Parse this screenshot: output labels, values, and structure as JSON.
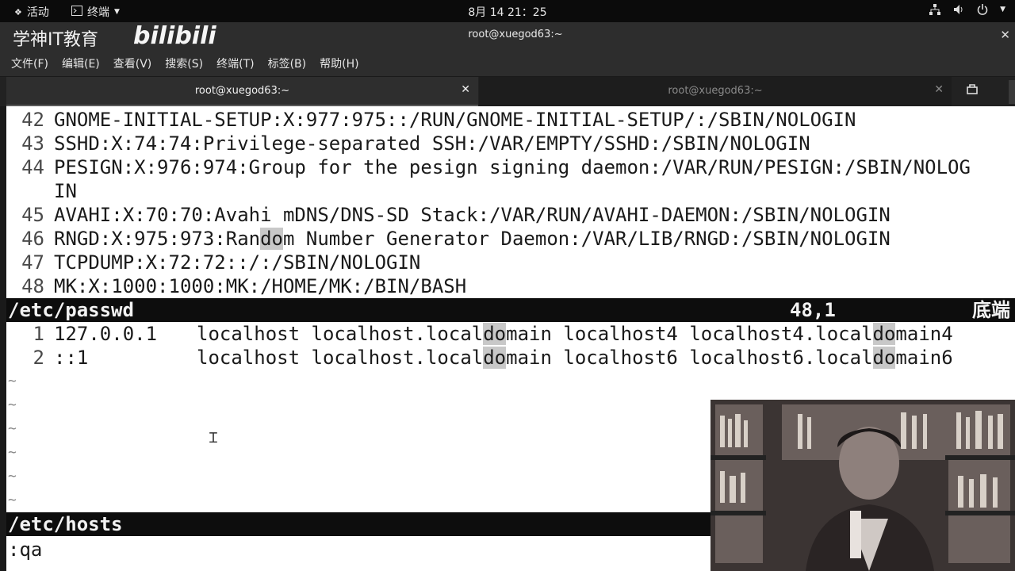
{
  "topbar": {
    "activities": "活动",
    "app": "终端",
    "clock": "8月 14  21：25"
  },
  "window": {
    "title": "root@xuegod63:~",
    "logo_text": "学神IT教育",
    "bili_text": "bilibili"
  },
  "menu": {
    "items": [
      "文件(F)",
      "编辑(E)",
      "查看(V)",
      "搜索(S)",
      "终端(T)",
      "标签(B)",
      "帮助(H)"
    ]
  },
  "tabs": [
    {
      "label": "root@xuegod63:~",
      "active": true
    },
    {
      "label": "root@xuegod63:~",
      "active": false
    }
  ],
  "passwd_lines": [
    {
      "num": "42",
      "text": "GNOME-INITIAL-SETUP:X:977:975::/RUN/GNOME-INITIAL-SETUP/:/SBIN/NOLOGIN"
    },
    {
      "num": "43",
      "text": "SSHD:X:74:74:Privilege-separated SSH:/VAR/EMPTY/SSHD:/SBIN/NOLOGIN"
    },
    {
      "num": "44",
      "text": "PESIGN:X:976:974:Group for the pesign signing daemon:/VAR/RUN/PESIGN:/SBIN/NOLOG"
    },
    {
      "num": "",
      "text": "IN"
    },
    {
      "num": "45",
      "text": "AVAHI:X:70:70:Avahi mDNS/DNS-SD Stack:/VAR/RUN/AVAHI-DAEMON:/SBIN/NOLOGIN"
    },
    {
      "num": "46",
      "text_pre": "RNGD:X:975:973:Ran",
      "text_hl": "do",
      "text_post": "m Number Generator Daemon:/VAR/LIB/RNGD:/SBIN/NOLOGIN"
    },
    {
      "num": "47",
      "text": "TCPDUMP:X:72:72::/:/SBIN/NOLOGIN"
    },
    {
      "num": "48",
      "text": "MK:X:1000:1000:MK:/HOME/MK:/BIN/BASH"
    }
  ],
  "status1": {
    "file": "/etc/passwd",
    "pos": "48,1",
    "where": "底端"
  },
  "hosts_lines": [
    {
      "num": "1",
      "addr": "127.0.0.1",
      "a": "localhost localhost.local",
      "b": "main localhost4 localhost4.local",
      "c": "main4",
      "hl": "do"
    },
    {
      "num": "2",
      "addr": "::1",
      "a": "localhost localhost.local",
      "b": "main localhost6 localhost6.local",
      "c": "main6",
      "hl": "do"
    }
  ],
  "tildes": [
    "~",
    "~",
    "~",
    "~",
    "~",
    "~"
  ],
  "status2": {
    "file": "/etc/hosts"
  },
  "command": ":qa"
}
